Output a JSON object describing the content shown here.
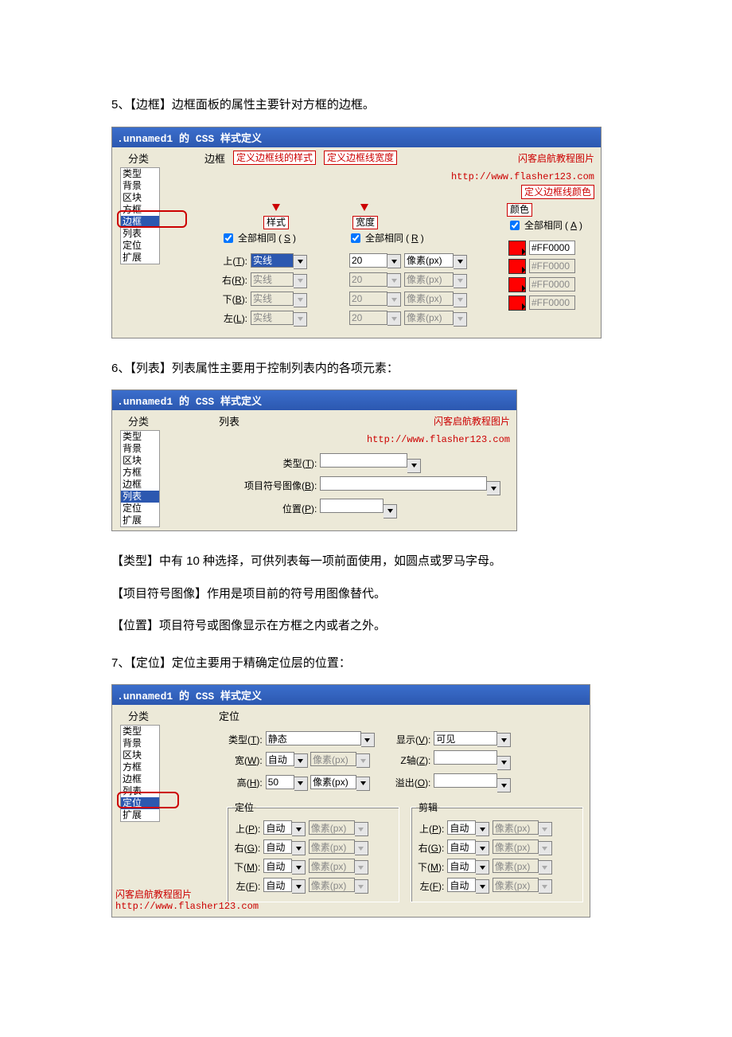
{
  "sections": {
    "s5": {
      "heading": "5、【边框】边框面板的属性主要针对方框的边框。"
    },
    "s6": {
      "heading": "6、【列表】列表属性主要用于控制列表内的各项元素：",
      "note1": "【类型】中有 10 种选择，可供列表每一项前面使用，如圆点或罗马字母。",
      "note2": "【项目符号图像】作用是项目前的符号用图像替代。",
      "note3": "【位置】项目符号或图像显示在方框之内或者之外。"
    },
    "s7": {
      "heading": "7、【定位】定位主要用于精确定位层的位置："
    }
  },
  "common": {
    "dialog_title": ".unnamed1 的 CSS 样式定义",
    "sidebar_label": "分类",
    "categories": [
      "类型",
      "背景",
      "区块",
      "方框",
      "边框",
      "列表",
      "定位",
      "扩展"
    ],
    "all_same": "全部相同",
    "unit": "像素(px)",
    "sides": {
      "top": "上",
      "right": "右",
      "bottom": "下",
      "left": "左"
    },
    "watermark": {
      "t": "闪客启航教程图片",
      "u": "http://www.flasher123.com"
    }
  },
  "border_dialog": {
    "panel": "边框",
    "callouts": {
      "style": "定义边框线的样式",
      "width": "定义边框线宽度",
      "color": "定义边框线颜色"
    },
    "groups": {
      "style": "样式",
      "width": "宽度",
      "color": "颜色"
    },
    "shortcuts": {
      "style": "S",
      "width": "R",
      "color": "A",
      "top": "T",
      "right": "R",
      "bottom": "B",
      "left": "L"
    },
    "style_value": "实线",
    "width_value": "20",
    "color_value": "#FF0000"
  },
  "list_dialog": {
    "panel": "列表",
    "labels": {
      "type": "类型",
      "bullet": "项目符号图像",
      "position": "位置"
    },
    "shortcuts": {
      "type": "T",
      "bullet": "B",
      "position": "P"
    }
  },
  "pos_dialog": {
    "panel": "定位",
    "labels": {
      "type": "类型",
      "width": "宽",
      "height": "高",
      "visibility": "显示",
      "z": "Z轴",
      "overflow": "溢出",
      "pos_group": "定位",
      "clip_group": "剪辑",
      "top": "上",
      "right": "右",
      "bottom": "下",
      "left": "左"
    },
    "shortcuts": {
      "type": "T",
      "width": "W",
      "height": "H",
      "visibility": "V",
      "z": "Z",
      "overflow": "O",
      "ptop": "P",
      "pright": "G",
      "pbottom": "M",
      "pleft": "F",
      "ctop": "P",
      "cright": "G",
      "cbottom": "M",
      "cleft": "F"
    },
    "values": {
      "type": "静态",
      "visibility": "可见",
      "height": "50"
    },
    "auto": "自动"
  }
}
